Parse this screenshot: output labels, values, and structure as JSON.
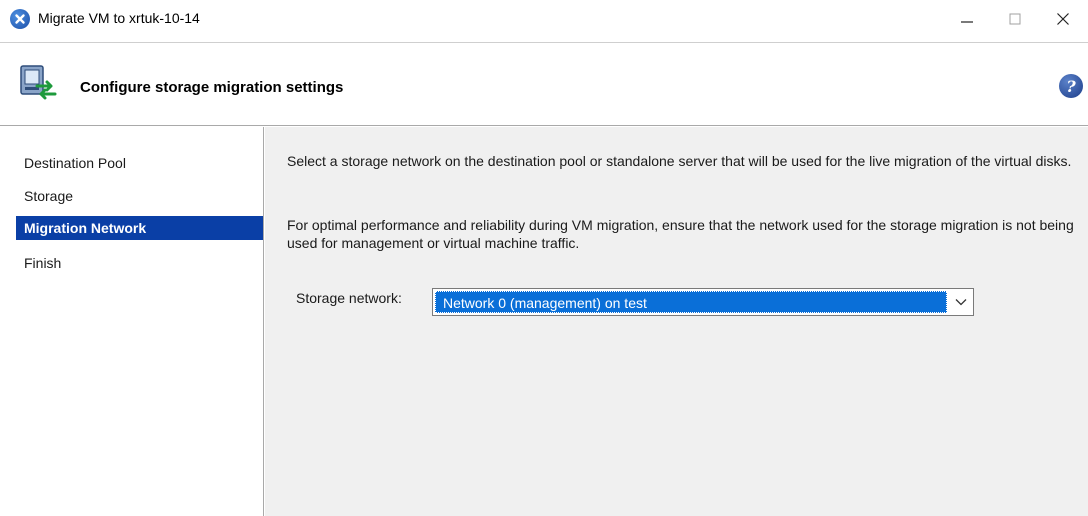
{
  "window": {
    "title": "Migrate VM to xrtuk-10-14",
    "controls": {
      "minimize": "minimize-icon",
      "maximize": "maximize-icon",
      "close": "close-icon"
    }
  },
  "header": {
    "title": "Configure storage migration settings",
    "help_icon": "?"
  },
  "sidebar": {
    "items": [
      {
        "label": "Destination Pool",
        "active": false
      },
      {
        "label": "Storage",
        "active": false
      },
      {
        "label": "Migration Network",
        "active": true
      },
      {
        "label": "Finish",
        "active": false
      }
    ]
  },
  "main": {
    "paragraph1": "Select a storage network on the destination pool or standalone server that will be used for the live migration of the virtual disks.",
    "paragraph2": "For optimal performance and reliability during VM migration, ensure that the network used for the storage migration is not being used for management or virtual machine traffic.",
    "storage_network": {
      "label": "Storage network:",
      "selected": "Network 0 (management) on test"
    }
  },
  "colors": {
    "selection": "#0a3fa6",
    "dropdown_highlight": "#0a6fd8",
    "content_bg": "#f0f0f0"
  }
}
